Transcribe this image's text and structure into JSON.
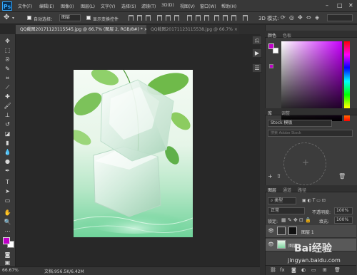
{
  "app": {
    "logo": "Ps"
  },
  "menu": [
    "文件(F)",
    "编辑(E)",
    "图像(I)",
    "图层(L)",
    "文字(Y)",
    "选择(S)",
    "滤镜(T)",
    "3D(D)",
    "视图(V)",
    "窗口(W)",
    "帮助(H)"
  ],
  "window_controls": [
    "–",
    "□",
    "✕"
  ],
  "options": {
    "auto_select_label": "自动选择：",
    "auto_select_value": "图层",
    "show_transform_label": "显示变换控件"
  },
  "tabs": [
    {
      "label": "QQ截图20171123115545.jpg @ 66.7% (图层 2, RGB/8#) *",
      "close": "×"
    },
    {
      "label": "QQ截图20171123115538.jpg @ 66.7%",
      "close": "×"
    }
  ],
  "status": {
    "zoom": "66.67%",
    "doc": "文档:956.5K/6.42M"
  },
  "panels": {
    "color_tabs": [
      "颜色",
      "色板"
    ],
    "library_tabs": [
      "库",
      "调整"
    ],
    "library_select": "Stock 模板",
    "library_search_placeholder": "搜索 Adobe Stock",
    "layers_tabs": [
      "图层",
      "通道",
      "路径"
    ],
    "kind_label": "类型",
    "blend_mode": "正常",
    "opacity_label": "不透明度:",
    "opacity_value": "100%",
    "lock_label": "锁定:",
    "fill_label": "填充:",
    "fill_value": "100%",
    "layers": [
      {
        "name": "图层 1"
      },
      {
        "name": "图层"
      }
    ]
  },
  "watermark": {
    "brand": "Bai经验",
    "url": "jingyan.baidu.com"
  },
  "colors": {
    "foreground": "#c000c8",
    "background": "#ffffff",
    "accent": "#31a8ff"
  }
}
